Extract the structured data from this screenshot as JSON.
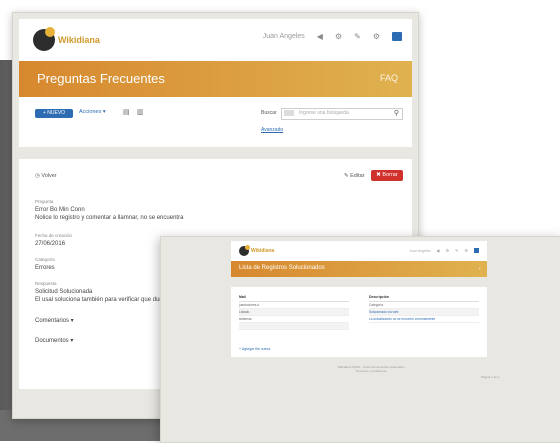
{
  "app": {
    "logo_text": "Wikidiana",
    "page_title": "Preguntas Frecuentes",
    "band_right": "FAQ",
    "user_name": "Juan Angeles",
    "header_icons": [
      "home-icon",
      "tools-icon",
      "wrench-icon",
      "gear-icon",
      "menu-icon"
    ]
  },
  "toolbar": {
    "new_label": "+ NUEVO",
    "actions_label": "Acciones ▾",
    "search_label": "Buscar",
    "search_placeholder": "Ingrese una búsqueda",
    "advanced_link": "Avanzado"
  },
  "card": {
    "back_label": "◷ Volver",
    "edit_label": "✎ Editar",
    "delete_label": "✖ Borrar",
    "fields": [
      {
        "label": "Pregunta",
        "value": "Error Bo Min Conn\nNolice lo registro y comentar a llamnar, no se encuentra"
      },
      {
        "label": "Fecha de creación",
        "value": "27/06/2016"
      },
      {
        "label": "Categoría",
        "value": "Errores"
      },
      {
        "label": "Respuesta",
        "value": "Solicitud Solucionada\nEl usal soluciona también para verificar que durante..."
      }
    ],
    "fold_1": "Comentarios ▾",
    "fold_2": "Documentos ▾"
  },
  "window2": {
    "logo_text": "Wikidiana",
    "page_title": "Lista de Registros Solucionados",
    "band_right": "+",
    "user_name": "Juan Angeles",
    "left_table": {
      "header": "Mail",
      "rows": [
        "juanbotones.d",
        "Listado",
        "sistemas",
        ""
      ]
    },
    "right_table": {
      "header": "Descripción",
      "rows": [
        "Categoría",
        "Solucionado vía web",
        "La actualización no se encontró correctamente"
      ]
    },
    "add_link": "+ Agregar fila nueva",
    "footer_line1": "Wikidiana ©2016 - Todos los derechos reservados",
    "footer_line2": "Términos y condiciones",
    "corner_text": "Página 1 de 1"
  }
}
